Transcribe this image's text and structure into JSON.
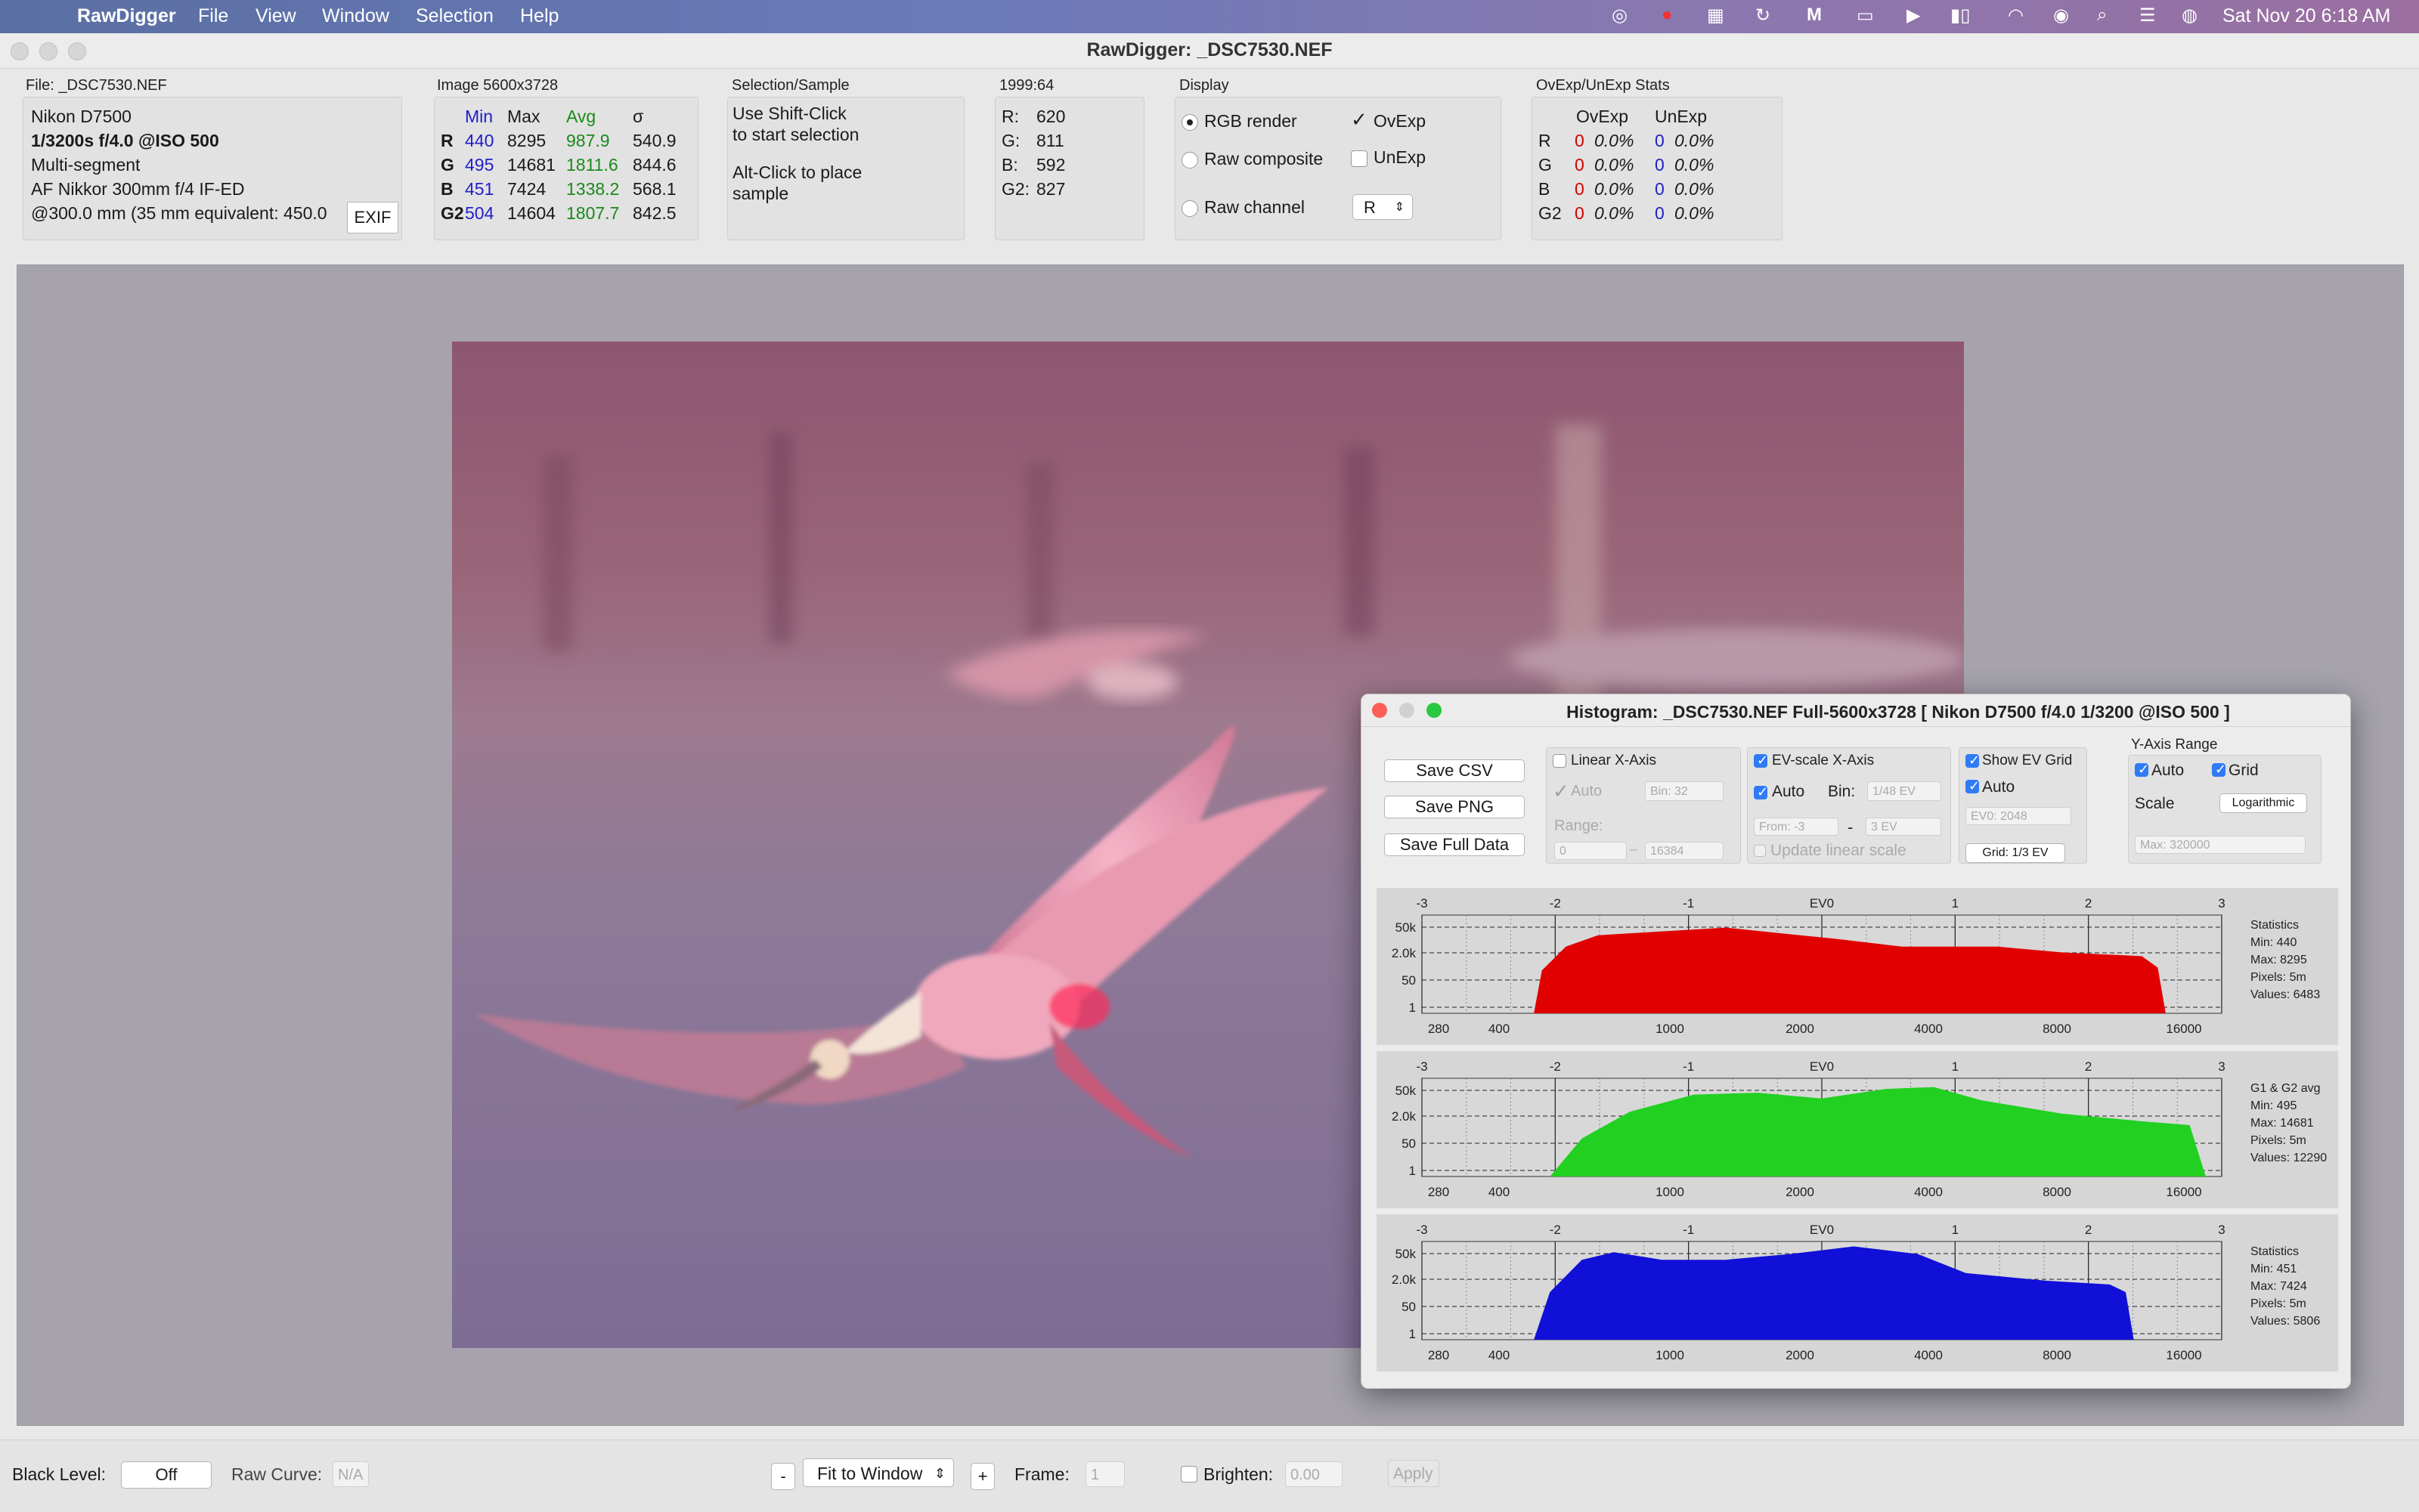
{
  "menubar": {
    "app": "RawDigger",
    "items": [
      "File",
      "View",
      "Window",
      "Selection",
      "Help"
    ],
    "datetime": "Sat Nov 20  6:18 AM"
  },
  "window": {
    "title": "RawDigger: _DSC7530.NEF"
  },
  "file_panel": {
    "label": "File: _DSC7530.NEF",
    "camera": "Nikon D7500",
    "exposure": "1/3200s f/4.0 @ISO 500",
    "metering": "Multi-segment",
    "lens": "AF Nikkor 300mm f/4 IF-ED",
    "focal": "@300.0 mm (35 mm equivalent: 450.0",
    "exif_button": "EXIF"
  },
  "image_panel": {
    "label": "Image 5600x3728",
    "headers": [
      "Min",
      "Max",
      "Avg",
      "σ"
    ],
    "rows": [
      {
        "ch": "R",
        "min": "440",
        "max": "8295",
        "avg": "987.9",
        "sd": "540.9"
      },
      {
        "ch": "G",
        "min": "495",
        "max": "14681",
        "avg": "1811.6",
        "sd": "844.6"
      },
      {
        "ch": "B",
        "min": "451",
        "max": "7424",
        "avg": "1338.2",
        "sd": "568.1"
      },
      {
        "ch": "G2",
        "min": "504",
        "max": "14604",
        "avg": "1807.7",
        "sd": "842.5"
      }
    ]
  },
  "selection_panel": {
    "label": "Selection/Sample",
    "line1": "Use Shift-Click",
    "line2": "to start selection",
    "line3": "Alt-Click to place",
    "line4": "sample"
  },
  "pixel_panel": {
    "label": "1999:64",
    "rows": [
      {
        "ch": "R:",
        "val": "620"
      },
      {
        "ch": "G:",
        "val": "811"
      },
      {
        "ch": "B:",
        "val": "592"
      },
      {
        "ch": "G2:",
        "val": "827"
      }
    ]
  },
  "display_panel": {
    "label": "Display",
    "rgb_render": "RGB render",
    "raw_composite": "Raw composite",
    "raw_channel": "Raw channel",
    "ovexp": "OvExp",
    "unexp": "UnExp",
    "channel_select": "R"
  },
  "stats_panel": {
    "label": "OvExp/UnExp Stats",
    "headers": [
      "OvExp",
      "UnExp"
    ],
    "rows": [
      {
        "ch": "R",
        "ov": "0",
        "ovp": "0.0%",
        "un": "0",
        "unp": "0.0%"
      },
      {
        "ch": "G",
        "ov": "0",
        "ovp": "0.0%",
        "un": "0",
        "unp": "0.0%"
      },
      {
        "ch": "B",
        "ov": "0",
        "ovp": "0.0%",
        "un": "0",
        "unp": "0.0%"
      },
      {
        "ch": "G2",
        "ov": "0",
        "ovp": "0.0%",
        "un": "0",
        "unp": "0.0%"
      }
    ]
  },
  "histogram": {
    "title": "Histogram: _DSC7530.NEF Full-5600x3728 [ Nikon D7500 f/4.0 1/3200 @ISO 500 ]",
    "buttons": {
      "save_csv": "Save CSV",
      "save_png": "Save PNG",
      "save_full": "Save Full Data"
    },
    "linear": {
      "label": "Linear X-Axis",
      "auto": "Auto",
      "bin": "Bin: 32",
      "range": "Range:",
      "from": "0",
      "to": "16384"
    },
    "ev": {
      "label": "EV-scale X-Axis",
      "auto": "Auto",
      "bin_label": "Bin:",
      "bin": "1/48 EV",
      "from": "From: -3",
      "to": "3 EV",
      "update": "Update linear scale"
    },
    "evgrid": {
      "label": "Show EV Grid",
      "auto": "Auto",
      "ev0": "EV0: 2048",
      "grid": "Grid: 1/3 EV"
    },
    "yaxis": {
      "label": "Y-Axis Range",
      "auto": "Auto",
      "grid": "Grid",
      "scale_label": "Scale",
      "scale": "Logarithmic",
      "max": "Max: 320000"
    },
    "ev_ticks": [
      "-3",
      "-2",
      "-1",
      "EV0",
      "1",
      "2",
      "3"
    ],
    "y_ticks": [
      "50k",
      "2.0k",
      "50",
      "1"
    ],
    "x_ticks": [
      "280",
      "400",
      "1000",
      "2000",
      "4000",
      "8000",
      "16000"
    ],
    "colors": {
      "red": "#e00000",
      "green": "#22d022",
      "blue": "#1010d8"
    },
    "panels": [
      {
        "name": "R",
        "stat_title": "Statistics",
        "min": "Min: 440",
        "max": "Max: 8295",
        "pixels": "Pixels: 5m",
        "values": "Values: 6483"
      },
      {
        "name": "G",
        "stat_title": "G1 & G2 avg",
        "min": "Min: 495",
        "max": "Max: 14681",
        "pixels": "Pixels: 5m",
        "values": "Values: 12290"
      },
      {
        "name": "B",
        "stat_title": "Statistics",
        "min": "Min: 451",
        "max": "Max: 7424",
        "pixels": "Pixels: 5m",
        "values": "Values: 5806"
      }
    ]
  },
  "bottombar": {
    "black_level_label": "Black Level:",
    "black_level": "Off",
    "raw_curve_label": "Raw Curve:",
    "raw_curve": "N/A",
    "zoom_minus": "-",
    "zoom": "Fit to Window",
    "zoom_plus": "+",
    "frame_label": "Frame:",
    "frame": "1",
    "brighten_label": "Brighten:",
    "brighten": "0.00",
    "apply": "Apply"
  }
}
